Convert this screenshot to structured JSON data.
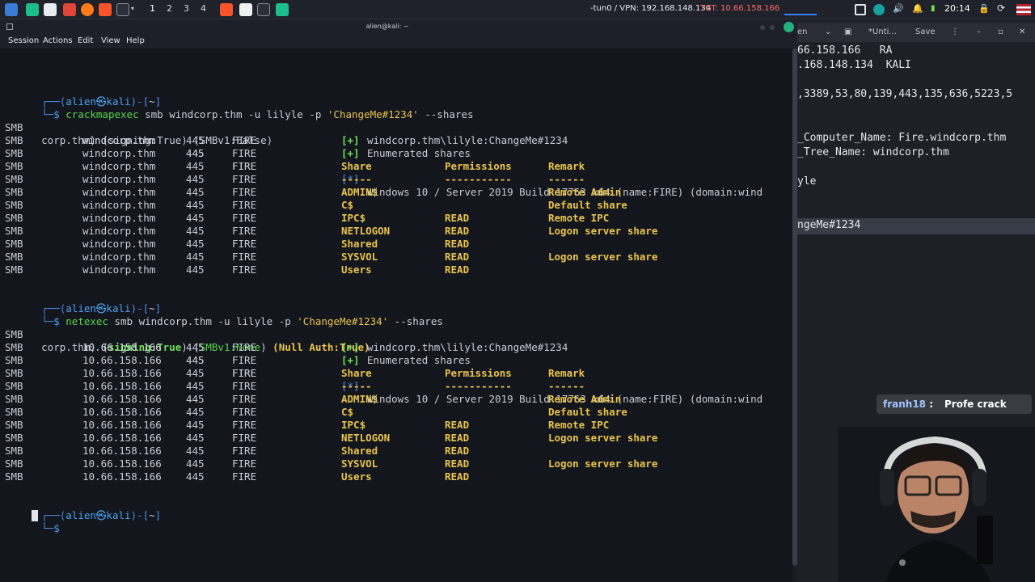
{
  "taskbar": {
    "workspaces": [
      "1",
      "2",
      "3",
      "4"
    ],
    "vpn": "-tun0 / VPN: 192.168.148.134",
    "target": "TGT: 10.66.158.166",
    "time": "20:14"
  },
  "terminal": {
    "title": "alien@kali: ~",
    "menu": [
      "Session",
      "Actions",
      "Edit",
      "View",
      "Help"
    ],
    "prompt": {
      "user": "alien",
      "at": "㉿",
      "host": "kali",
      "dir": "~"
    },
    "block1": {
      "command": "crackmapexec",
      "args": " smb windcorp.thm -u lilyle -p ",
      "password": "'ChangeMe#1234'",
      "flag": " --shares",
      "banner": "Windows 10 / Server 2019 Build 17763 x64 (name:FIRE) (domain:wind",
      "banner2": "corp.thm) (signing:True) (SMBv1:False)",
      "target": "windcorp.thm"
    },
    "block2": {
      "command": "netexec",
      "args": " smb windcorp.thm -u lilyle -p ",
      "password": "'ChangeMe#1234'",
      "flag": " --shares",
      "banner": "Windows 10 / Server 2019 Build 17763 x64 (name:FIRE) (domain:wind",
      "banner2_a": "corp.thm) (",
      "banner2_b": "signing:True",
      "banner2_c": ") (",
      "banner2_d": "SMBv1:None",
      "banner2_e": ") ",
      "banner2_f": "(Null Auth:True)",
      "target": "10.66.158.166"
    },
    "common": {
      "proto": "SMB",
      "port": "445",
      "name": "FIRE",
      "plus": "[+]",
      "star": "[*]",
      "auth": "windcorp.thm\\lilyle:ChangeMe#1234",
      "enum": "Enumerated shares",
      "col_share": "Share",
      "col_perm": "Permissions",
      "col_remark": "Remark",
      "ul_share": "-----",
      "ul_perm": "-----------",
      "ul_remark": "------"
    },
    "shares": [
      {
        "share": "ADMIN$",
        "perm": "",
        "remark": "Remote Admin"
      },
      {
        "share": "C$",
        "perm": "",
        "remark": "Default share"
      },
      {
        "share": "IPC$",
        "perm": "READ",
        "remark": "Remote IPC"
      },
      {
        "share": "NETLOGON",
        "perm": "READ",
        "remark": "Logon server share"
      },
      {
        "share": "Shared",
        "perm": "READ",
        "remark": ""
      },
      {
        "share": "SYSVOL",
        "perm": "READ",
        "remark": "Logon server share"
      },
      {
        "share": "Users",
        "perm": "READ",
        "remark": ""
      }
    ],
    "prompt_symbol": "$"
  },
  "right_window": {
    "tabs": [
      "en",
      "*Unti...",
      "Save"
    ],
    "lines": [
      "66.158.166   RA",
      ".168.148.134  KALI",
      ",3389,53,80,139,443,135,636,5223,5",
      "_Computer_Name: Fire.windcorp.thm",
      "_Tree_Name: windcorp.thm",
      "yle",
      "ngeMe#1234"
    ]
  },
  "chat": {
    "user": "franh18",
    "sep": " : ",
    "message": "Profe crack"
  },
  "colors": {
    "accent_blue": "#4c8be5",
    "accent_yellow": "#e9c44b",
    "accent_green": "#58d44b",
    "terminal_bg": "#14161d"
  }
}
